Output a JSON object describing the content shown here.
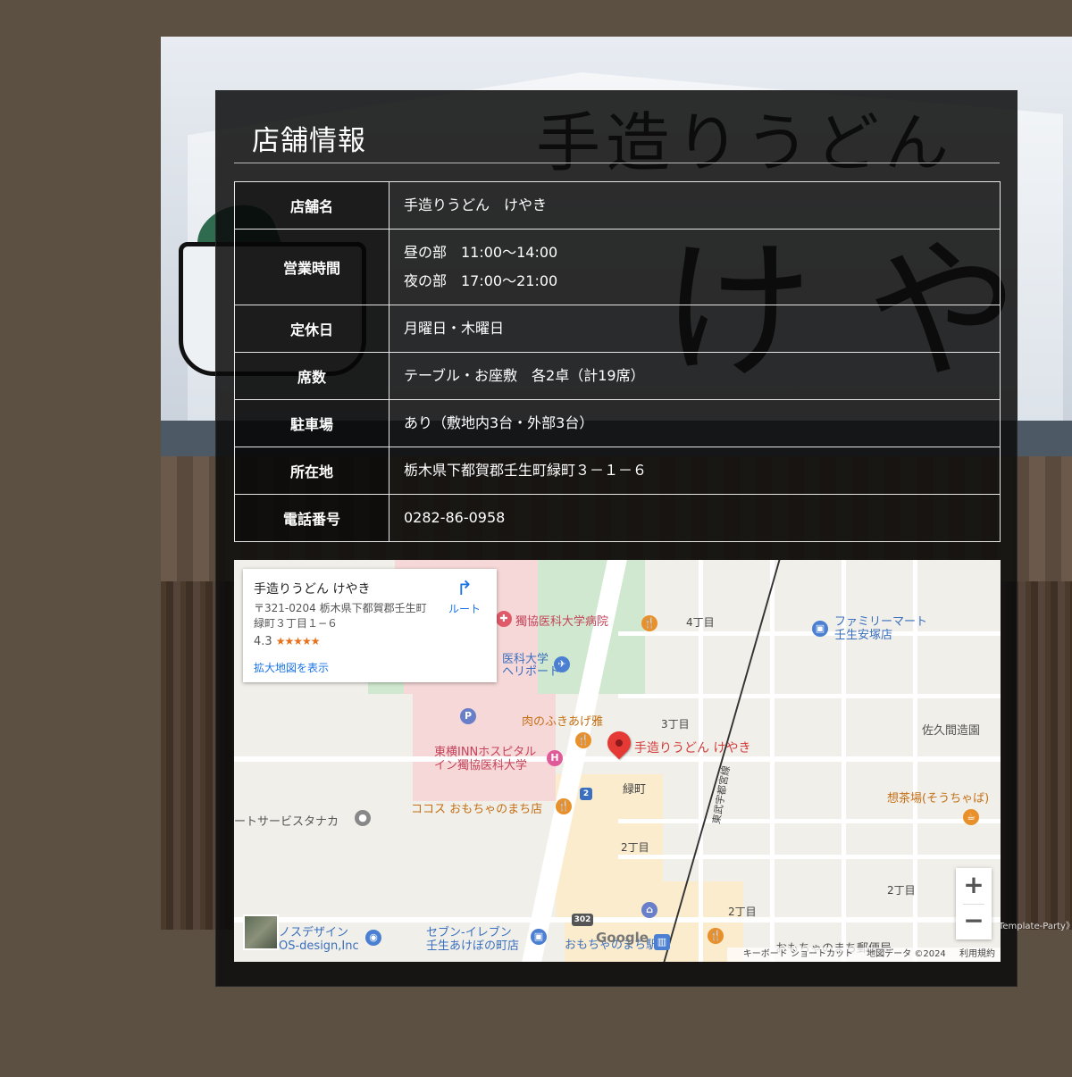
{
  "panel": {
    "title": "店舗情報"
  },
  "rows": [
    {
      "label": "店舗名",
      "lines": [
        "手造りうどん　けやき"
      ]
    },
    {
      "label": "営業時間",
      "lines": [
        "昼の部　11:00〜14:00",
        "夜の部　17:00〜21:00"
      ]
    },
    {
      "label": "定休日",
      "lines": [
        "月曜日・木曜日"
      ]
    },
    {
      "label": "席数",
      "lines": [
        "テーブル・お座敷　各2卓（計19席）"
      ]
    },
    {
      "label": "駐車場",
      "lines": [
        "あり（敷地内3台・外部3台）"
      ]
    },
    {
      "label": "所在地",
      "lines": [
        "栃木県下都賀郡壬生町緑町３－１－６"
      ]
    },
    {
      "label": "電話番号",
      "lines": [
        "0282-86-0958"
      ]
    }
  ],
  "map": {
    "card": {
      "title": "手造りうどん けやき",
      "address": "〒321-0204 栃木県下都賀郡壬生町緑町３丁目１−６",
      "rating": "4.3",
      "stars": "★★★★★",
      "link": "拡大地図を表示",
      "route": "ルート"
    },
    "zoom_in": "+",
    "zoom_out": "−",
    "google": "Google",
    "attribution": {
      "shortcuts": "キーボード ショートカット",
      "data": "地図データ ©2024",
      "terms": "利用規約"
    },
    "labels": {
      "hospital": "獨協医科大学病院",
      "heliport": "医科大学\nヘリポート",
      "nikuno": "肉のふきあげ雅",
      "marker": "手造りうどん けやき",
      "toyoko": "東横INNホスピタル\nイン獨協医科大学",
      "cocos": "ココス おもちゃのまち店",
      "service": "ートサービスタナカ",
      "familymart": "ファミリーマート\n壬生安塚店",
      "sakuma": "佐久間造園",
      "sochaba": "想茶場(そうちゃば)",
      "seven": "セブン-イレブン\n壬生あけぼの町店",
      "design": "ノスデザイン\nOS-design,Inc",
      "omocha": "おもちゃのまち駅",
      "post": "おもちゃのまち郵便局",
      "midori": "緑町",
      "c4": "4丁目",
      "c3": "3丁目",
      "c2": "2丁目",
      "c2b": "2丁目",
      "c2c": "2丁目",
      "line": "東武宇都宮線",
      "route2": "2",
      "route302": "302"
    }
  },
  "footer_snippet": "Template-Party》"
}
